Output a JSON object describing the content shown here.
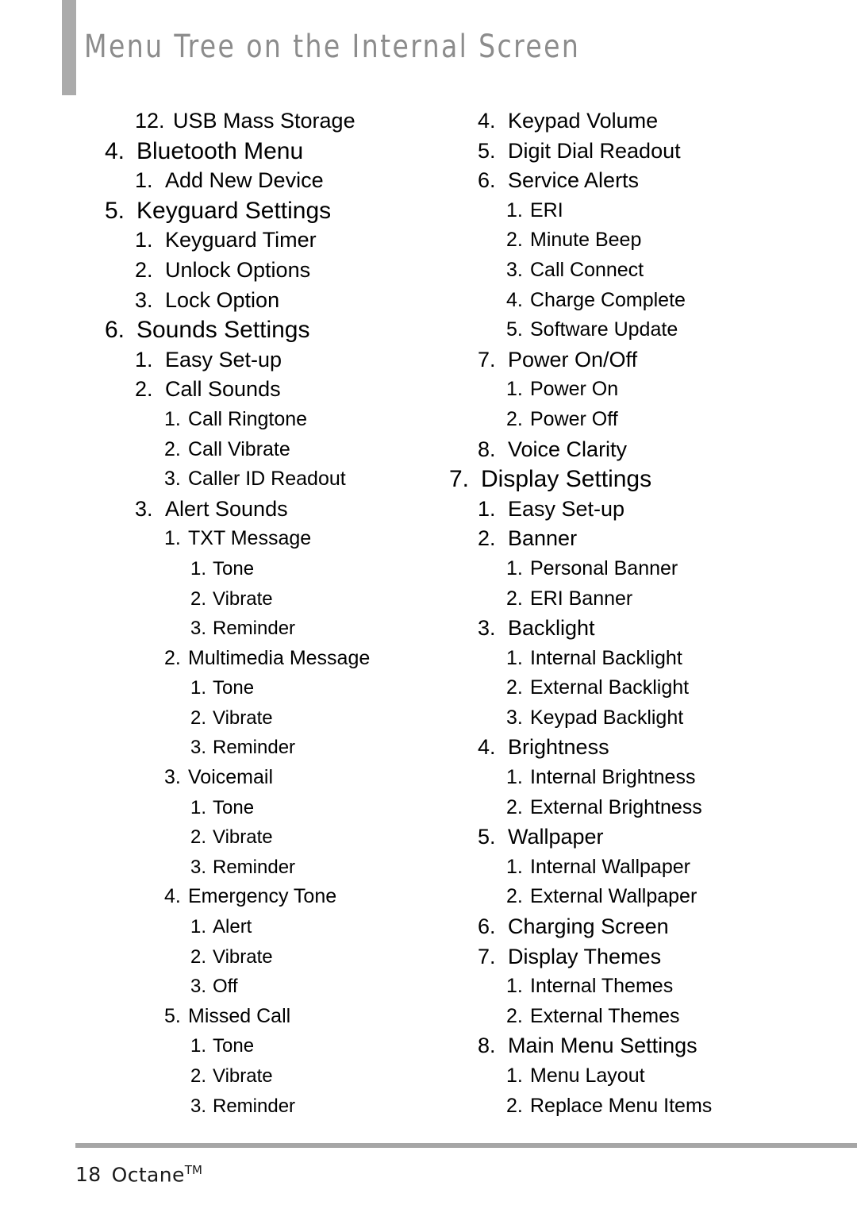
{
  "header": {
    "title": "Menu Tree on the Internal Screen",
    "accent_color": "#ababab",
    "title_color": "#8c8c8c"
  },
  "footer": {
    "page_number": "18",
    "product_name": "Octane",
    "trademark": "TM",
    "rule_color": "#a6a6a6"
  },
  "menu_tree": {
    "left_column": [
      {
        "level": 2,
        "num": "12.",
        "text": "USB Mass Storage"
      },
      {
        "level": 1,
        "num": "4.",
        "text": "Bluetooth Menu"
      },
      {
        "level": 2,
        "num": "1.",
        "text": "Add New Device"
      },
      {
        "level": 1,
        "num": "5.",
        "text": "Keyguard Settings"
      },
      {
        "level": 2,
        "num": "1.",
        "text": "Keyguard Timer"
      },
      {
        "level": 2,
        "num": "2.",
        "text": "Unlock Options"
      },
      {
        "level": 2,
        "num": "3.",
        "text": "Lock Option"
      },
      {
        "level": 1,
        "num": "6.",
        "text": "Sounds Settings"
      },
      {
        "level": 2,
        "num": "1.",
        "text": "Easy Set-up"
      },
      {
        "level": 2,
        "num": "2.",
        "text": "Call Sounds"
      },
      {
        "level": 3,
        "num": "1.",
        "text": "Call Ringtone"
      },
      {
        "level": 3,
        "num": "2.",
        "text": "Call Vibrate"
      },
      {
        "level": 3,
        "num": "3.",
        "text": "Caller ID Readout"
      },
      {
        "level": 2,
        "num": "3.",
        "text": "Alert Sounds"
      },
      {
        "level": 3,
        "num": "1.",
        "text": "TXT Message"
      },
      {
        "level": 4,
        "num": "1.",
        "text": "Tone"
      },
      {
        "level": 4,
        "num": "2.",
        "text": "Vibrate"
      },
      {
        "level": 4,
        "num": "3.",
        "text": "Reminder"
      },
      {
        "level": 3,
        "num": "2.",
        "text": "Multimedia Message"
      },
      {
        "level": 4,
        "num": "1.",
        "text": "Tone"
      },
      {
        "level": 4,
        "num": "2.",
        "text": "Vibrate"
      },
      {
        "level": 4,
        "num": "3.",
        "text": "Reminder"
      },
      {
        "level": 3,
        "num": "3.",
        "text": "Voicemail"
      },
      {
        "level": 4,
        "num": "1.",
        "text": "Tone"
      },
      {
        "level": 4,
        "num": "2.",
        "text": "Vibrate"
      },
      {
        "level": 4,
        "num": "3.",
        "text": "Reminder"
      },
      {
        "level": 3,
        "num": "4.",
        "text": "Emergency Tone"
      },
      {
        "level": 4,
        "num": "1.",
        "text": "Alert"
      },
      {
        "level": 4,
        "num": "2.",
        "text": "Vibrate"
      },
      {
        "level": 4,
        "num": "3.",
        "text": "Off"
      },
      {
        "level": 3,
        "num": "5.",
        "text": "Missed Call"
      },
      {
        "level": 4,
        "num": "1.",
        "text": "Tone"
      },
      {
        "level": 4,
        "num": "2.",
        "text": "Vibrate"
      },
      {
        "level": 4,
        "num": "3.",
        "text": "Reminder"
      }
    ],
    "right_column": [
      {
        "level": 2,
        "num": "4.",
        "text": "Keypad Volume"
      },
      {
        "level": 2,
        "num": "5.",
        "text": "Digit Dial Readout"
      },
      {
        "level": 2,
        "num": "6.",
        "text": "Service Alerts"
      },
      {
        "level": 3,
        "num": "1.",
        "text": "ERI"
      },
      {
        "level": 3,
        "num": "2.",
        "text": "Minute Beep"
      },
      {
        "level": 3,
        "num": "3.",
        "text": "Call Connect"
      },
      {
        "level": 3,
        "num": "4.",
        "text": "Charge Complete"
      },
      {
        "level": 3,
        "num": "5.",
        "text": "Software Update"
      },
      {
        "level": 2,
        "num": "7.",
        "text": "Power On/Off"
      },
      {
        "level": 3,
        "num": "1.",
        "text": "Power On"
      },
      {
        "level": 3,
        "num": "2.",
        "text": "Power Off"
      },
      {
        "level": 2,
        "num": "8.",
        "text": "Voice Clarity"
      },
      {
        "level": 1,
        "num": "7.",
        "text": "Display Settings"
      },
      {
        "level": 2,
        "num": "1.",
        "text": "Easy Set-up"
      },
      {
        "level": 2,
        "num": "2.",
        "text": "Banner"
      },
      {
        "level": 3,
        "num": "1.",
        "text": "Personal Banner"
      },
      {
        "level": 3,
        "num": "2.",
        "text": "ERI Banner"
      },
      {
        "level": 2,
        "num": "3.",
        "text": "Backlight"
      },
      {
        "level": 3,
        "num": "1.",
        "text": "Internal Backlight"
      },
      {
        "level": 3,
        "num": "2.",
        "text": "External Backlight"
      },
      {
        "level": 3,
        "num": "3.",
        "text": "Keypad Backlight"
      },
      {
        "level": 2,
        "num": "4.",
        "text": "Brightness"
      },
      {
        "level": 3,
        "num": "1.",
        "text": "Internal Brightness"
      },
      {
        "level": 3,
        "num": "2.",
        "text": "External Brightness"
      },
      {
        "level": 2,
        "num": "5.",
        "text": "Wallpaper"
      },
      {
        "level": 3,
        "num": "1.",
        "text": "Internal Wallpaper"
      },
      {
        "level": 3,
        "num": "2.",
        "text": "External Wallpaper"
      },
      {
        "level": 2,
        "num": "6.",
        "text": "Charging Screen"
      },
      {
        "level": 2,
        "num": "7.",
        "text": "Display Themes"
      },
      {
        "level": 3,
        "num": "1.",
        "text": "Internal Themes"
      },
      {
        "level": 3,
        "num": "2.",
        "text": "External Themes"
      },
      {
        "level": 2,
        "num": "8.",
        "text": "Main Menu Settings"
      },
      {
        "level": 3,
        "num": "1.",
        "text": "Menu Layout"
      },
      {
        "level": 3,
        "num": "2.",
        "text": "Replace Menu Items"
      }
    ]
  }
}
